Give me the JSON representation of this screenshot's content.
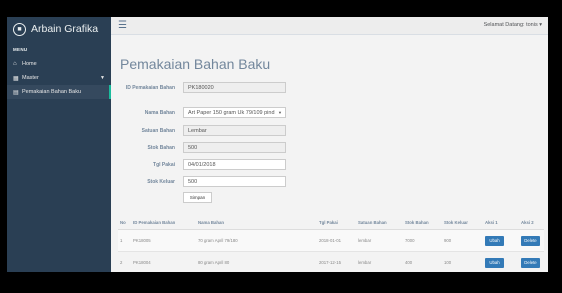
{
  "app": {
    "title": "Arbain Grafika"
  },
  "sidebar": {
    "menu_heading": "MENU",
    "items": [
      {
        "label": "Home",
        "icon": "home-icon"
      },
      {
        "label": "Master",
        "icon": "table-icon"
      },
      {
        "label": "Pemakaian Bahan Baku",
        "icon": "list-icon"
      }
    ]
  },
  "topbar": {
    "user_text": "Selamat Datang: tonis"
  },
  "page": {
    "title": "Pemakaian Bahan Baku"
  },
  "form": {
    "id_label": "ID Pemakaian Bahan",
    "id_value": "PK180020",
    "nama_label": "Nama Bahan",
    "nama_value": "Art Paper 150 gram Uk 79/109 pind",
    "satuan_label": "Satuan Bahan",
    "satuan_value": "Lembar",
    "stok_label": "Stok Bahan",
    "stok_value": "500",
    "tgl_label": "Tgl Pakai",
    "tgl_value": "04/01/2018",
    "keluar_label": "Stok Keluar",
    "keluar_value": "500",
    "submit_label": "Simpan"
  },
  "table": {
    "headers": [
      "No",
      "ID Pemakaian Bahan",
      "Nama Bahan",
      "Tgl Pakai",
      "Satuan Bahan",
      "Stok Bahan",
      "Stok Keluar",
      "Aksi 1",
      "Aksi 2"
    ],
    "rows": [
      {
        "no": "1",
        "id": "PK18005",
        "nama": "70 gram April 79/180",
        "tgl": "2018-01-01",
        "satuan": "lembar",
        "stok": "7000",
        "keluar": "900",
        "edit": "Ubah",
        "del": "Delete"
      },
      {
        "no": "2",
        "id": "PK18004",
        "nama": "80 gram April 80",
        "tgl": "2017-12-15",
        "satuan": "lembar",
        "stok": "400",
        "keluar": "100",
        "edit": "Ubah",
        "del": "Delete"
      }
    ]
  }
}
